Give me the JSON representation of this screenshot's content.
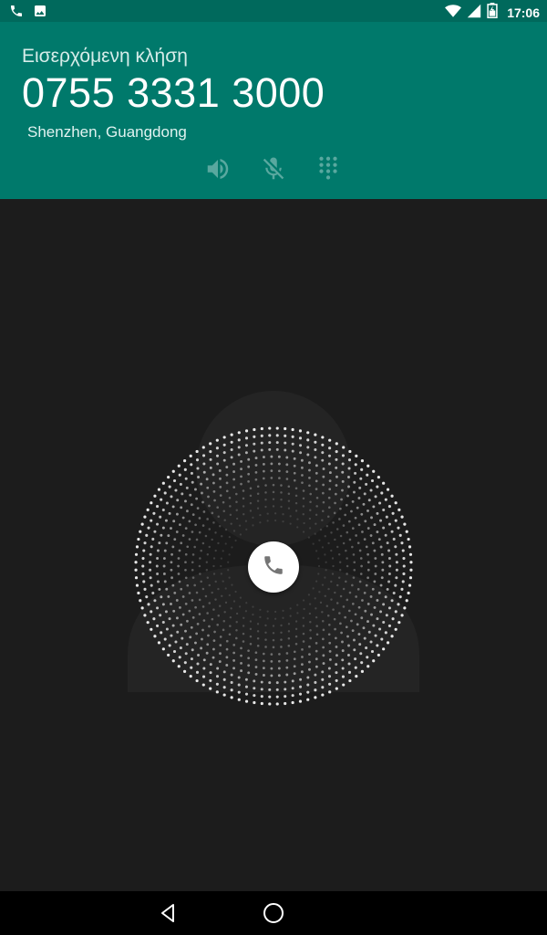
{
  "status_bar": {
    "time": "17:06",
    "left_icons": [
      "phone-icon",
      "image-icon"
    ],
    "right_icons": [
      "wifi-icon",
      "signal-icon",
      "battery-icon"
    ]
  },
  "call": {
    "label": "Εισερχόμενη κλήση",
    "number": "0755 3331 3000",
    "location": "Shenzhen, Guangdong"
  },
  "call_actions": {
    "icons": [
      "speaker-icon",
      "mute-mic-icon",
      "dialpad-icon"
    ],
    "enabled": false
  },
  "answer": {
    "icon": "phone-icon"
  },
  "nav_bar": {
    "icons": [
      "back-icon",
      "home-icon"
    ]
  },
  "colors": {
    "header": "#00796b",
    "status_bar": "#00695c",
    "background": "#1c1c1c",
    "nav_bar": "#000000"
  }
}
